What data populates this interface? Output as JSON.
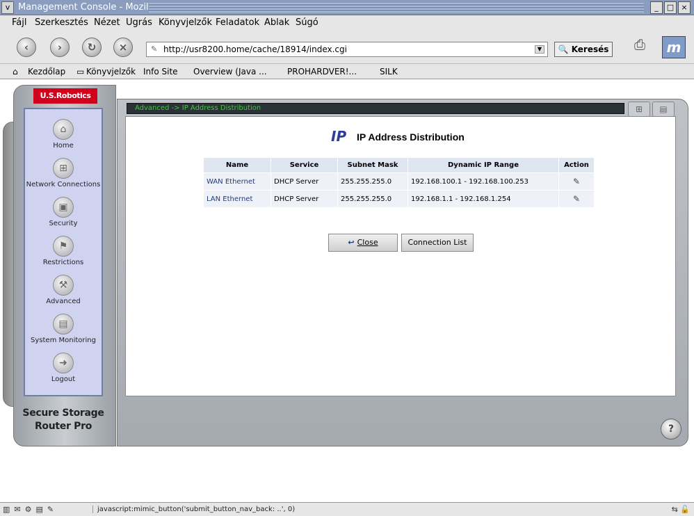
{
  "window": {
    "title": "Management Console - Mozilla",
    "sys_icon": "chevron-down-icon",
    "controls": [
      "minimize-icon",
      "maximize-icon",
      "close-icon"
    ]
  },
  "menu": [
    "Fájl",
    "Szerkesztés",
    "Nézet",
    "Ugrás",
    "Könyvjelzők",
    "Feladatok",
    "Ablak",
    "Súgó"
  ],
  "nav": {
    "url": "http://usr8200.home/cache/18914/index.cgi",
    "search_label": "Keresés"
  },
  "bookmarks": [
    "Kezdőlap",
    "Könyvjelzők",
    "Info Site",
    "Overview (Java ...",
    "PROHARDVER!...",
    "SILK"
  ],
  "router": {
    "logo": "U.S.Robotics",
    "product_line1": "Secure Storage",
    "product_line2": "Router Pro",
    "breadcrumb": "Advanced -> IP Address Distribution",
    "sidebar": [
      {
        "label": "Home",
        "icon": "home-icon"
      },
      {
        "label": "Network Connections",
        "icon": "network-icon"
      },
      {
        "label": "Security",
        "icon": "lock-icon"
      },
      {
        "label": "Restrictions",
        "icon": "restrictions-icon"
      },
      {
        "label": "Advanced",
        "icon": "tools-icon"
      },
      {
        "label": "System Monitoring",
        "icon": "monitor-icon"
      },
      {
        "label": "Logout",
        "icon": "logout-icon"
      }
    ]
  },
  "page": {
    "title": "IP Address Distribution",
    "icon_text": "IP",
    "table": {
      "headers": [
        "Name",
        "Service",
        "Subnet Mask",
        "Dynamic IP Range",
        "Action"
      ],
      "rows": [
        {
          "name": "WAN Ethernet",
          "service": "DHCP Server",
          "mask": "255.255.255.0",
          "range": "192.168.100.1 - 192.168.100.253"
        },
        {
          "name": "LAN Ethernet",
          "service": "DHCP Server",
          "mask": "255.255.255.0",
          "range": "192.168.1.1 - 192.168.1.254"
        }
      ]
    },
    "close_label": "Close",
    "connection_list_label": "Connection List"
  },
  "status": {
    "text": "javascript:mimic_button('submit_button_nav_back: ..', 0)"
  },
  "colors": {
    "titlebar": "#8a9dbf",
    "logo_red": "#d0021b",
    "breadcrumb_green": "#35d035",
    "nav_panel": "#cfd3f0"
  }
}
